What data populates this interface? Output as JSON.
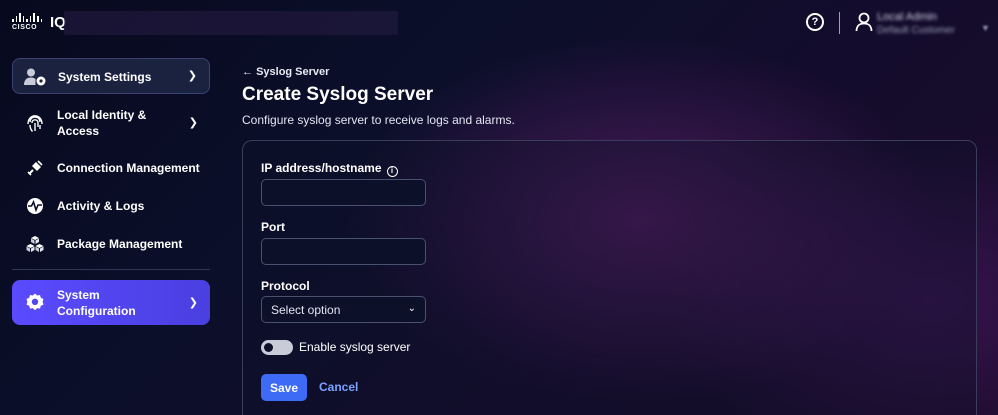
{
  "header": {
    "logo_text": "CISCO",
    "app_name": "IQ",
    "user": {
      "name": "Local Admin",
      "org": "Default Customer"
    }
  },
  "sidebar": {
    "items": [
      {
        "label": "System Settings",
        "icon": "user-settings-icon"
      },
      {
        "label": "Local Identity & Access",
        "icon": "fingerprint-icon"
      },
      {
        "label": "Connection Management",
        "icon": "plug-icon"
      },
      {
        "label": "Activity & Logs",
        "icon": "activity-icon"
      },
      {
        "label": "Package Management",
        "icon": "package-icon"
      },
      {
        "label": "System Configuration",
        "icon": "gear-icon"
      }
    ]
  },
  "main": {
    "back_label": "Syslog Server",
    "title": "Create Syslog Server",
    "description": "Configure syslog server to receive logs and alarms.",
    "form": {
      "ip_label": "IP address/hostname",
      "ip_value": "",
      "port_label": "Port",
      "port_value": "",
      "protocol_label": "Protocol",
      "protocol_selected": "Select option",
      "toggle_label": "Enable syslog server",
      "toggle_on": false,
      "save_label": "Save",
      "cancel_label": "Cancel"
    }
  },
  "colors": {
    "accent": "#3d6bf5",
    "nav_active_gradient_start": "#5a4bff",
    "link": "#7aa2ff"
  }
}
